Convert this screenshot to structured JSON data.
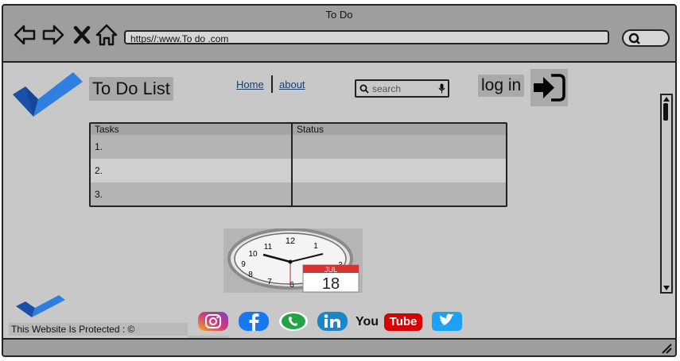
{
  "window": {
    "title": "To Do"
  },
  "browser": {
    "url": "https//:www.To do .com"
  },
  "header": {
    "title": "To Do List",
    "nav": {
      "home": "Home",
      "about": "about"
    },
    "search_placeholder": "search",
    "login_label": "log in"
  },
  "table": {
    "headers": [
      "Tasks",
      "Status"
    ],
    "rows": [
      {
        "task": "1.",
        "status": ""
      },
      {
        "task": "2.",
        "status": ""
      },
      {
        "task": "3.",
        "status": ""
      }
    ]
  },
  "calendar": {
    "month": "JUL",
    "day": "18"
  },
  "clock": {
    "numbers": [
      "12",
      "1",
      "3",
      "6",
      "7",
      "8",
      "9",
      "10",
      "11"
    ]
  },
  "footer": {
    "protected_text": "This Website Is Protected : ©",
    "social": {
      "youtube_you": "You",
      "youtube_tube": "Tube"
    }
  },
  "colors": {
    "logo_light": "#2f7fe0",
    "logo_dark": "#1b4fa8",
    "instagram": "#d13a7a",
    "facebook": "#1877f2",
    "whatsapp": "#25a244",
    "linkedin": "#1a86c9",
    "youtube": "#d90000",
    "twitter": "#1da1f2",
    "calendar_red": "#d63333"
  },
  "icons": {
    "back": "arrow-left-icon",
    "forward": "arrow-right-icon",
    "close": "close-icon",
    "home": "home-icon",
    "search": "search-icon",
    "mic": "microphone-icon",
    "login": "login-icon"
  }
}
